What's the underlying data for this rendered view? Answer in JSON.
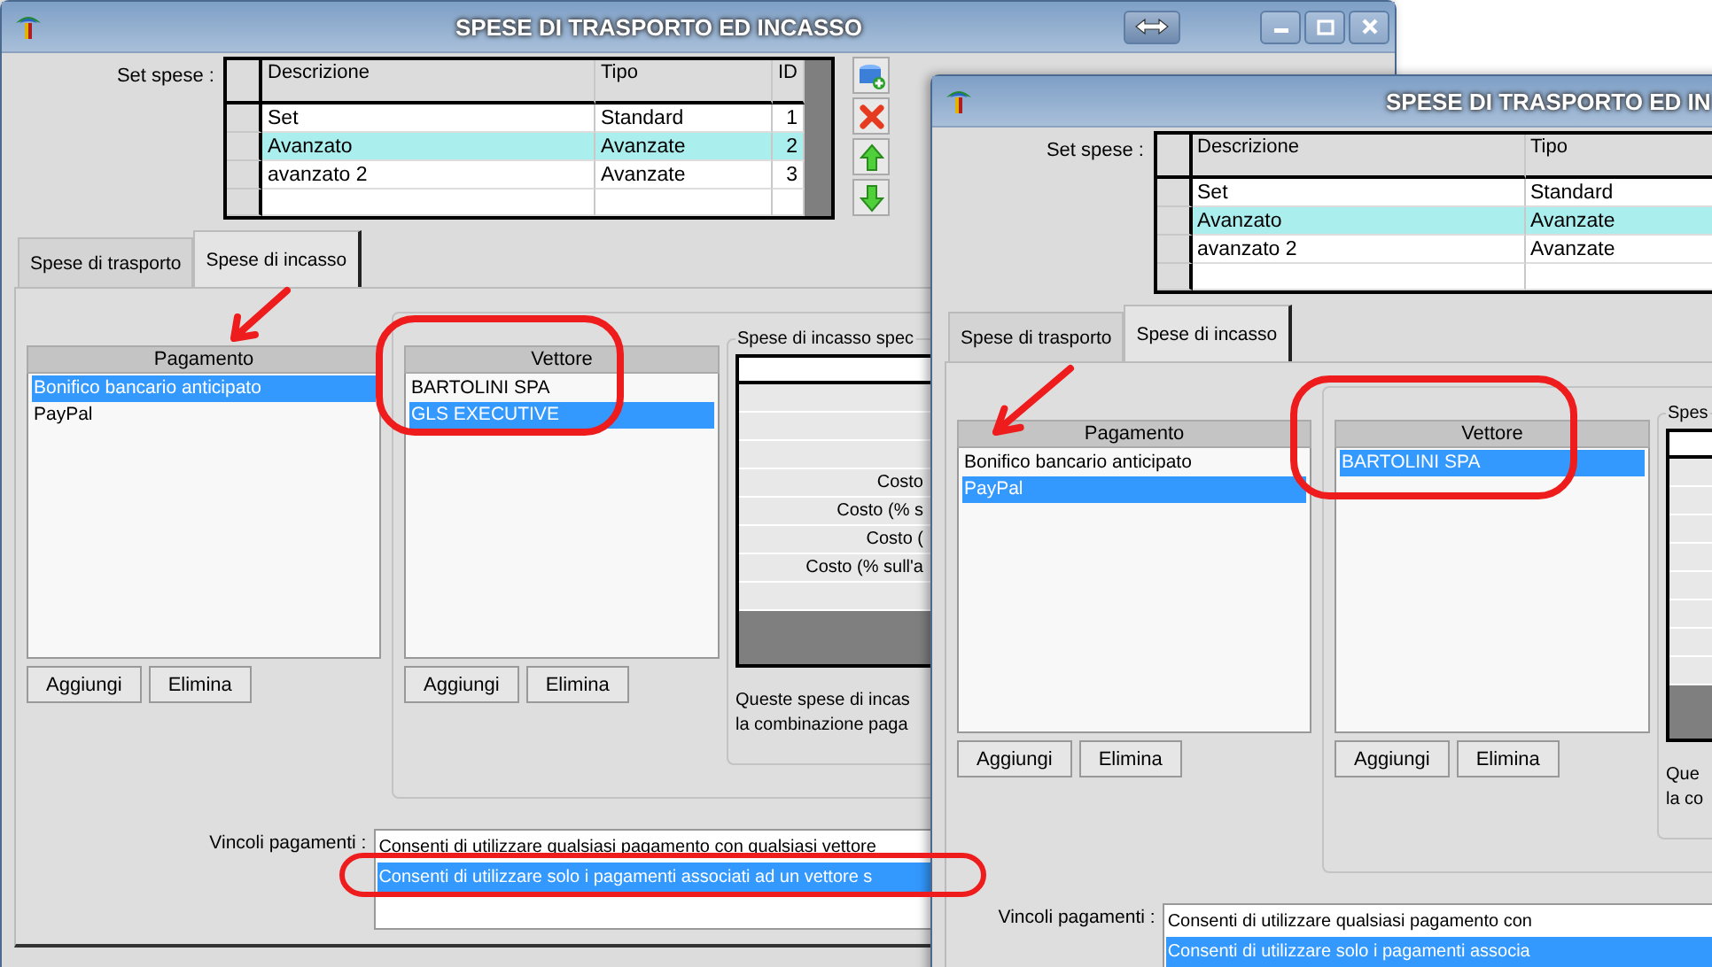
{
  "windows": [
    {
      "title": "SPESE DI TRASPORTO ED INCASSO",
      "controls": true,
      "toolbar": true,
      "set_spese": {
        "label": "Set spese :",
        "columns": [
          {
            "label": "Descrizione",
            "kind": "text"
          },
          {
            "label": "Tipo",
            "kind": "text"
          },
          {
            "label": "ID",
            "kind": "number"
          }
        ],
        "rows": [
          {
            "cells": [
              "Set",
              "Standard",
              "1"
            ],
            "selected": false
          },
          {
            "cells": [
              "Avanzato",
              "Avanzate",
              "2"
            ],
            "selected": true
          },
          {
            "cells": [
              "avanzato 2",
              "Avanzate",
              "3"
            ],
            "selected": false
          }
        ]
      },
      "tabs": [
        {
          "label": "Spese di trasporto",
          "selected": false
        },
        {
          "label": "Spese di incasso",
          "selected": true
        }
      ],
      "pagamento": {
        "header": "Pagamento",
        "items": [
          {
            "label": "Bonifico bancario anticipato",
            "selected": true
          },
          {
            "label": "PayPal",
            "selected": false
          }
        ],
        "buttons": [
          "Aggiungi",
          "Elimina"
        ]
      },
      "vettore": {
        "header": "Vettore",
        "items": [
          {
            "label": "BARTOLINI SPA",
            "selected": false
          },
          {
            "label": "GLS EXECUTIVE",
            "selected": true
          }
        ],
        "buttons": [
          "Aggiungi",
          "Elimina"
        ]
      },
      "spese_specifiche": {
        "title": "Spese di incasso spec",
        "costs": [
          "Costo",
          "Costo (% s",
          "Costo (",
          "Costo (% sull'a"
        ],
        "note": [
          "Queste spese di incas",
          "la combinazione paga"
        ]
      },
      "vincoli": {
        "label": "Vincoli pagamenti :",
        "options": [
          {
            "label": "Consenti di utilizzare qualsiasi pagamento con qualsiasi vettore",
            "selected": false
          },
          {
            "label": "Consenti di utilizzare solo i pagamenti associati ad un vettore s",
            "selected": true
          }
        ]
      }
    },
    {
      "title": "SPESE DI TRASPORTO ED IN",
      "set_spese": {
        "label": "Set spese :",
        "columns": [
          {
            "label": "Descrizione",
            "kind": "text"
          },
          {
            "label": "Tipo",
            "kind": "text"
          }
        ],
        "rows": [
          {
            "cells": [
              "Set",
              "Standard"
            ],
            "selected": false
          },
          {
            "cells": [
              "Avanzato",
              "Avanzate"
            ],
            "selected": true
          },
          {
            "cells": [
              "avanzato 2",
              "Avanzate"
            ],
            "selected": false
          }
        ]
      },
      "tabs": [
        {
          "label": "Spese di trasporto",
          "selected": false
        },
        {
          "label": "Spese di incasso",
          "selected": true
        }
      ],
      "pagamento": {
        "header": "Pagamento",
        "items": [
          {
            "label": "Bonifico bancario anticipato",
            "selected": false
          },
          {
            "label": "PayPal",
            "selected": true
          }
        ],
        "buttons": [
          "Aggiungi",
          "Elimina"
        ]
      },
      "vettore": {
        "header": "Vettore",
        "items": [
          {
            "label": "BARTOLINI SPA",
            "selected": true
          }
        ],
        "buttons": [
          "Aggiungi",
          "Elimina"
        ]
      },
      "spese_specifiche": {
        "title": "Spes",
        "note": [
          "Que",
          "la co"
        ]
      },
      "vincoli": {
        "label": "Vincoli pagamenti :",
        "options": [
          {
            "label": "Consenti di utilizzare qualsiasi pagamento con",
            "selected": false
          },
          {
            "label": "Consenti di utilizzare solo i pagamenti associa",
            "selected": true
          }
        ]
      }
    }
  ]
}
